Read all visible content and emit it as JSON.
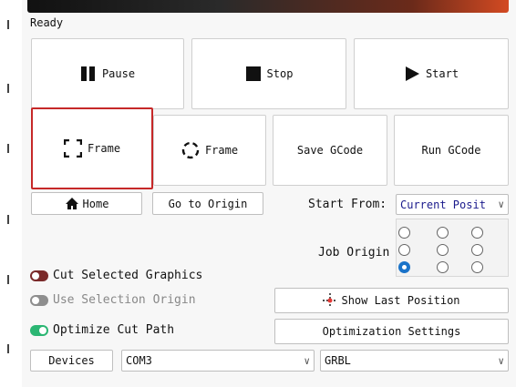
{
  "status": "Ready",
  "buttons": {
    "pause": "Pause",
    "stop": "Stop",
    "start": "Start",
    "frame_rect": "Frame",
    "frame_circle": "Frame",
    "save_gcode": "Save GCode",
    "run_gcode": "Run GCode",
    "home": "Home",
    "go_to_origin": "Go to Origin",
    "show_last_position": "Show Last Position",
    "optimization_settings": "Optimization Settings",
    "devices": "Devices"
  },
  "start_from": {
    "label": "Start From:",
    "value": "Current Posit"
  },
  "job_origin": {
    "label": "Job Origin",
    "selected_row": 2,
    "selected_col": 0
  },
  "toggles": {
    "cut_selected": "Cut Selected Graphics",
    "use_selection_origin": "Use Selection Origin",
    "optimize_cut_path": "Optimize Cut Path"
  },
  "port": {
    "value": "COM3"
  },
  "controller": {
    "value": "GRBL"
  },
  "colors": {
    "highlight": "#c62828",
    "accent": "#1a73c9",
    "toggle_on": "#2bb673"
  }
}
